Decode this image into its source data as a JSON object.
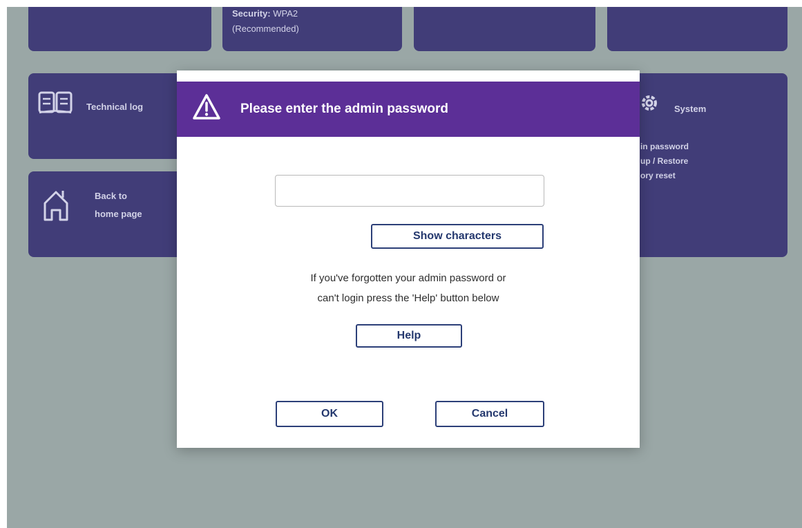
{
  "tiles": {
    "wireless": {
      "security_label": "Security:",
      "security_value": "WPA2",
      "security_note": "(Recommended)"
    },
    "technical_log": {
      "label": "Technical log",
      "icon": "book-icon"
    },
    "back_home": {
      "label_line1": "Back to",
      "label_line2": "home page",
      "icon": "home-icon"
    },
    "system": {
      "label": "System",
      "icon": "gear-icon",
      "items": [
        "in password",
        "up / Restore",
        "ory reset"
      ]
    }
  },
  "dialog": {
    "title": "Please enter the admin password",
    "icon": "warning-icon",
    "password_value": "",
    "show_characters_label": "Show characters",
    "help_text_line1": "If you've forgotten your admin password or",
    "help_text_line2": "can't login press the 'Help' button below",
    "help_label": "Help",
    "ok_label": "OK",
    "cancel_label": "Cancel"
  },
  "colors": {
    "tile": "#413d78",
    "header": "#5c2f97",
    "button_border": "#2c3f78",
    "background": "#9aa7a6"
  }
}
